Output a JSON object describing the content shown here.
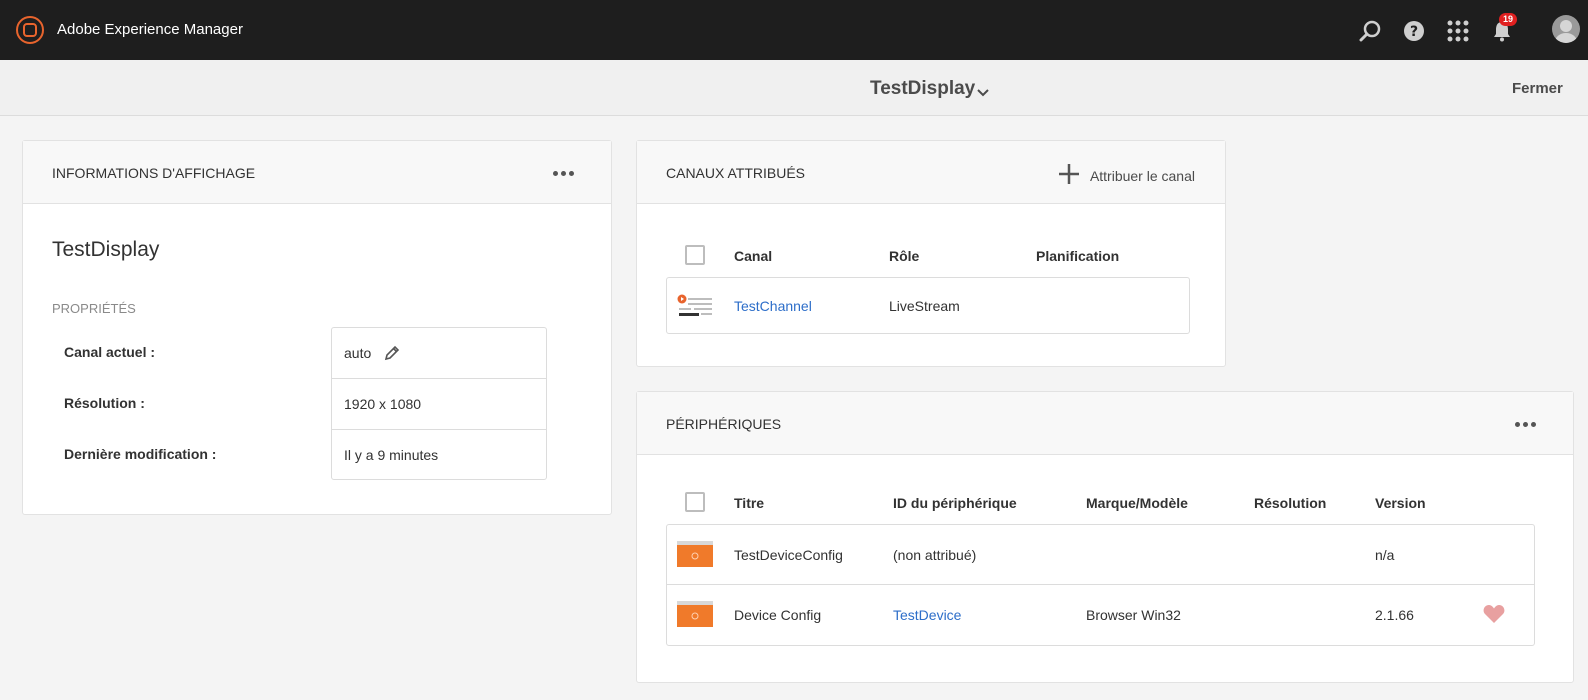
{
  "shell": {
    "app_title": "Adobe Experience Manager",
    "notifications_count": "19",
    "icons": [
      "search-icon",
      "help-icon",
      "apps-grid-icon",
      "bell-icon",
      "avatar-icon"
    ]
  },
  "actionbar": {
    "page_title": "TestDisplay",
    "close_label": "Fermer"
  },
  "info_card": {
    "heading": "INFORMATIONS D'AFFICHAGE",
    "display_name": "TestDisplay",
    "properties_heading": "PROPRIÉTÉS",
    "properties": [
      {
        "label": "Canal actuel :",
        "value": "auto"
      },
      {
        "label": "Résolution :",
        "value": "1920 x 1080"
      },
      {
        "label": "Dernière modification :",
        "value": "Il y a 9 minutes"
      }
    ]
  },
  "channels_card": {
    "heading": "CANAUX ATTRIBUÉS",
    "assign_label": "Attribuer le canal",
    "columns": [
      "Canal",
      "Rôle",
      "Planification"
    ],
    "rows": [
      {
        "channel": "TestChannel",
        "role": "LiveStream",
        "schedule": ""
      }
    ]
  },
  "devices_card": {
    "heading": "PÉRIPHÉRIQUES",
    "columns": [
      "Titre",
      "ID du périphérique",
      "Marque/Modèle",
      "Résolution",
      "Version"
    ],
    "rows": [
      {
        "title": "TestDeviceConfig",
        "device_id": "(non attribué)",
        "model": "",
        "resolution": "",
        "version": "n/a"
      },
      {
        "title": "Device Config",
        "device_id": "TestDevice",
        "model": "Browser Win32",
        "resolution": "",
        "version": "2.1.66"
      }
    ]
  },
  "colors": {
    "shell_bg": "#1e1e1e",
    "accent_orange": "#e8642d",
    "link_blue": "#2d6ec9",
    "heart_pink": "#e8a0a0"
  }
}
